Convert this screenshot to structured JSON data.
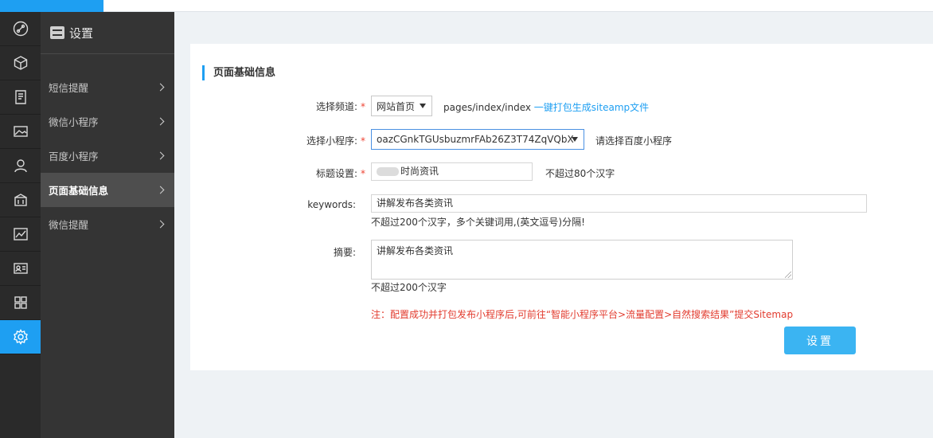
{
  "sidebar": {
    "icons": [
      "link-icon",
      "box-icon",
      "document-icon",
      "image-icon",
      "user-icon",
      "bank-icon",
      "chart-icon",
      "id-card-icon",
      "grid-icon",
      "gear-icon"
    ],
    "active_icon": "gear-icon"
  },
  "submenu": {
    "title": "设置",
    "items": [
      {
        "label": "短信提醒"
      },
      {
        "label": "微信小程序"
      },
      {
        "label": "百度小程序"
      },
      {
        "label": "页面基础信息"
      },
      {
        "label": "微信提醒"
      }
    ],
    "active_index": 3
  },
  "panel": {
    "title": "页面基础信息",
    "channel": {
      "label": "选择频道:",
      "required": "*",
      "selected": "网站首页",
      "path": "pages/index/index",
      "link": "一键打包生成siteamp文件"
    },
    "miniprogram": {
      "label": "选择小程序:",
      "required": "*",
      "selected": "oazCGnkTGUsbuzmrFAb26Z3T74ZqVQbX",
      "hint": "请选择百度小程序"
    },
    "title_setting": {
      "label": "标题设置:",
      "required": "*",
      "value": "时尚资讯",
      "hint": "不超过80个汉字"
    },
    "keywords": {
      "label": "keywords:",
      "value": "讲解发布各类资讯",
      "hint": "不超过200个汉字，多个关键词用,(英文逗号)分隔!"
    },
    "summary": {
      "label": "摘要:",
      "value": "讲解发布各类资讯",
      "hint": "不超过200个汉字"
    },
    "note": "注：配置成功并打包发布小程序后,可前往“智能小程序平台>流量配置>自然搜索结果”提交Sitemap",
    "submit_label": "设置"
  },
  "colors": {
    "accent": "#1e9ff2",
    "button": "#3bb4f2",
    "note": "#e23b2e",
    "rail_bg": "#2a2a2a",
    "submenu_bg": "#343434"
  }
}
